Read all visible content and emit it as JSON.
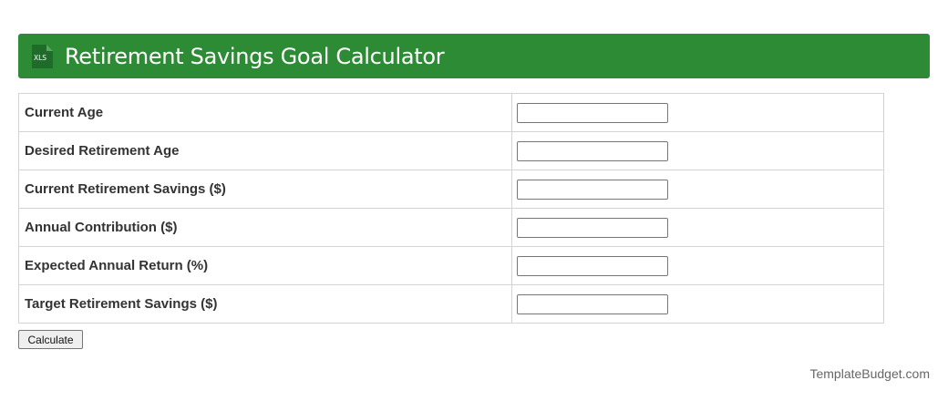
{
  "header": {
    "title": "Retirement Savings Goal Calculator",
    "icon": "xls-file-icon",
    "icon_text": "XLS",
    "background_color": "#2e8b35"
  },
  "form": {
    "rows": [
      {
        "label": "Current Age",
        "value": ""
      },
      {
        "label": "Desired Retirement Age",
        "value": ""
      },
      {
        "label": "Current Retirement Savings ($)",
        "value": ""
      },
      {
        "label": "Annual Contribution ($)",
        "value": ""
      },
      {
        "label": "Expected Annual Return (%)",
        "value": ""
      },
      {
        "label": "Target Retirement Savings ($)",
        "value": ""
      }
    ],
    "button_label": "Calculate"
  },
  "footer": {
    "credit": "TemplateBudget.com"
  }
}
